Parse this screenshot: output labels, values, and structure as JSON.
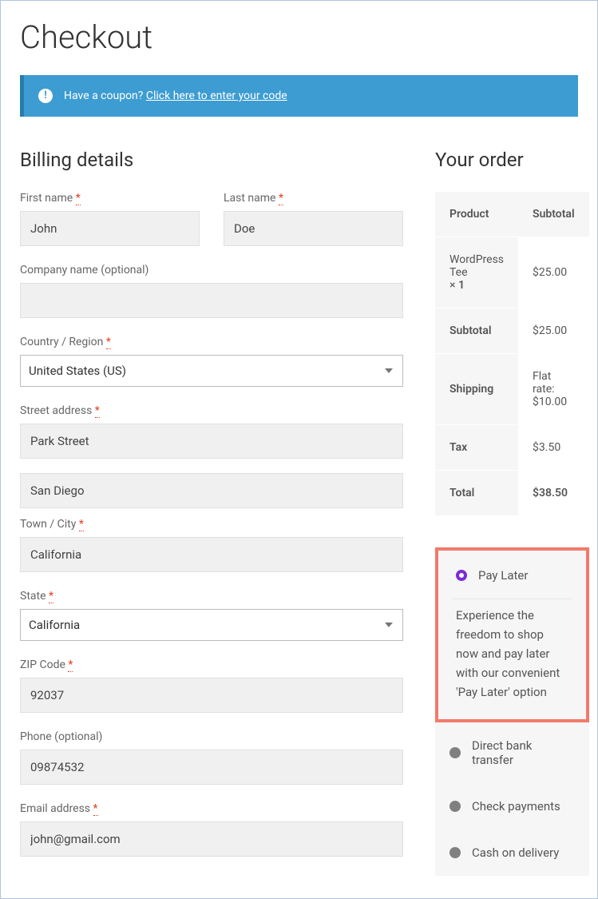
{
  "page": {
    "title": "Checkout"
  },
  "coupon": {
    "prompt": "Have a coupon? ",
    "link": "Click here to enter your code"
  },
  "billing": {
    "heading": "Billing details",
    "first_name": {
      "label": "First name",
      "value": "John"
    },
    "last_name": {
      "label": "Last name",
      "value": "Doe"
    },
    "company": {
      "label": "Company name (optional)",
      "value": ""
    },
    "country": {
      "label": "Country / Region",
      "value": "United States (US)"
    },
    "street": {
      "label": "Street address",
      "value1": "Park Street",
      "value2": "San Diego"
    },
    "city": {
      "label": "Town / City",
      "value": "California"
    },
    "state": {
      "label": "State",
      "value": "California"
    },
    "zip": {
      "label": "ZIP Code",
      "value": "92037"
    },
    "phone": {
      "label": "Phone (optional)",
      "value": "09874532"
    },
    "email": {
      "label": "Email address",
      "value": "john@gmail.com"
    }
  },
  "order": {
    "heading": "Your order",
    "columns": {
      "product": "Product",
      "subtotal": "Subtotal"
    },
    "items": [
      {
        "name": "WordPress Tee",
        "qty_prefix": "× ",
        "qty": "1",
        "price": "$25.00"
      }
    ],
    "subtotal": {
      "label": "Subtotal",
      "value": "$25.00"
    },
    "shipping": {
      "label": "Shipping",
      "value": "Flat rate: $10.00"
    },
    "tax": {
      "label": "Tax",
      "value": "$3.50"
    },
    "total": {
      "label": "Total",
      "value": "$38.50"
    }
  },
  "payment": {
    "methods": [
      {
        "id": "pay_later",
        "label": "Pay Later",
        "selected": true,
        "description": "Experience the freedom to shop now and pay later with our convenient 'Pay Later' option"
      },
      {
        "id": "bank",
        "label": "Direct bank transfer",
        "selected": false
      },
      {
        "id": "check",
        "label": "Check payments",
        "selected": false
      },
      {
        "id": "cod",
        "label": "Cash on delivery",
        "selected": false
      }
    ]
  },
  "required_mark": "*"
}
